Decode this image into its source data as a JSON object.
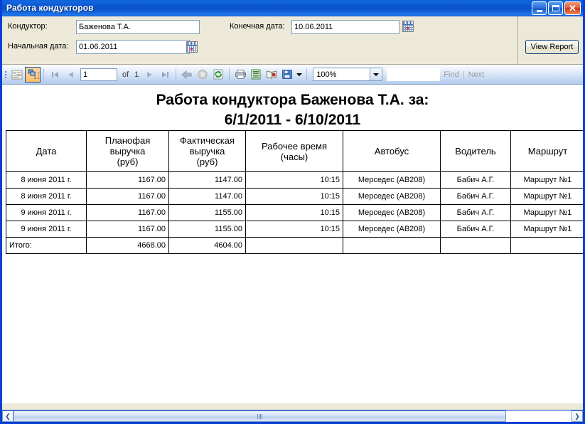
{
  "window": {
    "title": "Работа кондукторов",
    "buttons": {
      "minimize": "minimize-button",
      "maximize": "maximize-button",
      "close": "✕"
    }
  },
  "parameters": {
    "conductor_label": "Кондуктор:",
    "conductor_value": "Баженова Т.А.",
    "start_date_label": "Начальная дата:",
    "start_date_value": "01.06.2011",
    "end_date_label": "Конечная дата:",
    "end_date_value": "10.06.2011",
    "view_report_label": "View Report"
  },
  "toolbar": {
    "page_value": "1",
    "of_label": "of",
    "total_pages": "1",
    "zoom_value": "100%",
    "find_label": "Find",
    "find_separator": "|",
    "next_label": "Next",
    "find_input_value": "",
    "icons": [
      "document-map-icon",
      "parameters-icon",
      "first-page-icon",
      "previous-page-icon",
      "next-page-icon",
      "last-page-icon",
      "back-icon",
      "stop-icon",
      "refresh-icon",
      "print-icon",
      "print-layout-icon",
      "page-setup-icon",
      "export-icon",
      "export-dropdown-icon"
    ]
  },
  "report": {
    "title_line1": "Работа кондуктора Баженова Т.А. за:",
    "title_line2": "6/1/2011 - 6/10/2011",
    "columns": [
      "Дата",
      "Планофая\nвыручка\n(руб)",
      "Фактическая\nвыручка\n(руб)",
      "Рабочее время\n(часы)",
      "Автобус",
      "Водитель",
      "Маршрут"
    ],
    "rows": [
      {
        "date": "8 июня 2011 г.",
        "plan": "1167.00",
        "fact": "1147.00",
        "time": "10:15",
        "bus": "Мерседес (AB208)",
        "driver": "Бабич А.Г.",
        "route": "Маршрут №1"
      },
      {
        "date": "8 июня 2011 г.",
        "plan": "1167.00",
        "fact": "1147.00",
        "time": "10:15",
        "bus": "Мерседес (AB208)",
        "driver": "Бабич А.Г.",
        "route": "Маршрут №1"
      },
      {
        "date": "9 июня 2011 г.",
        "plan": "1167.00",
        "fact": "1155.00",
        "time": "10:15",
        "bus": "Мерседес (AB208)",
        "driver": "Бабич А.Г.",
        "route": "Маршрут №1"
      },
      {
        "date": "9 июня 2011 г.",
        "plan": "1167.00",
        "fact": "1155.00",
        "time": "10:15",
        "bus": "Мерседес (AB208)",
        "driver": "Бабич А.Г.",
        "route": "Маршрут №1"
      }
    ],
    "total": {
      "date": "Итого:",
      "plan": "4668.00",
      "fact": "4604.00",
      "time": "",
      "bus": "",
      "driver": "",
      "route": ""
    }
  },
  "colors": {
    "titlebar_blue": "#0a55cf",
    "window_border": "#0a3fd4",
    "panel_bg": "#ece9d8",
    "toolbar_top": "#eaf1fb",
    "toolbar_bottom": "#b3cbed",
    "active_button": "#fbc069",
    "disabled_text": "#9a9a9a"
  }
}
